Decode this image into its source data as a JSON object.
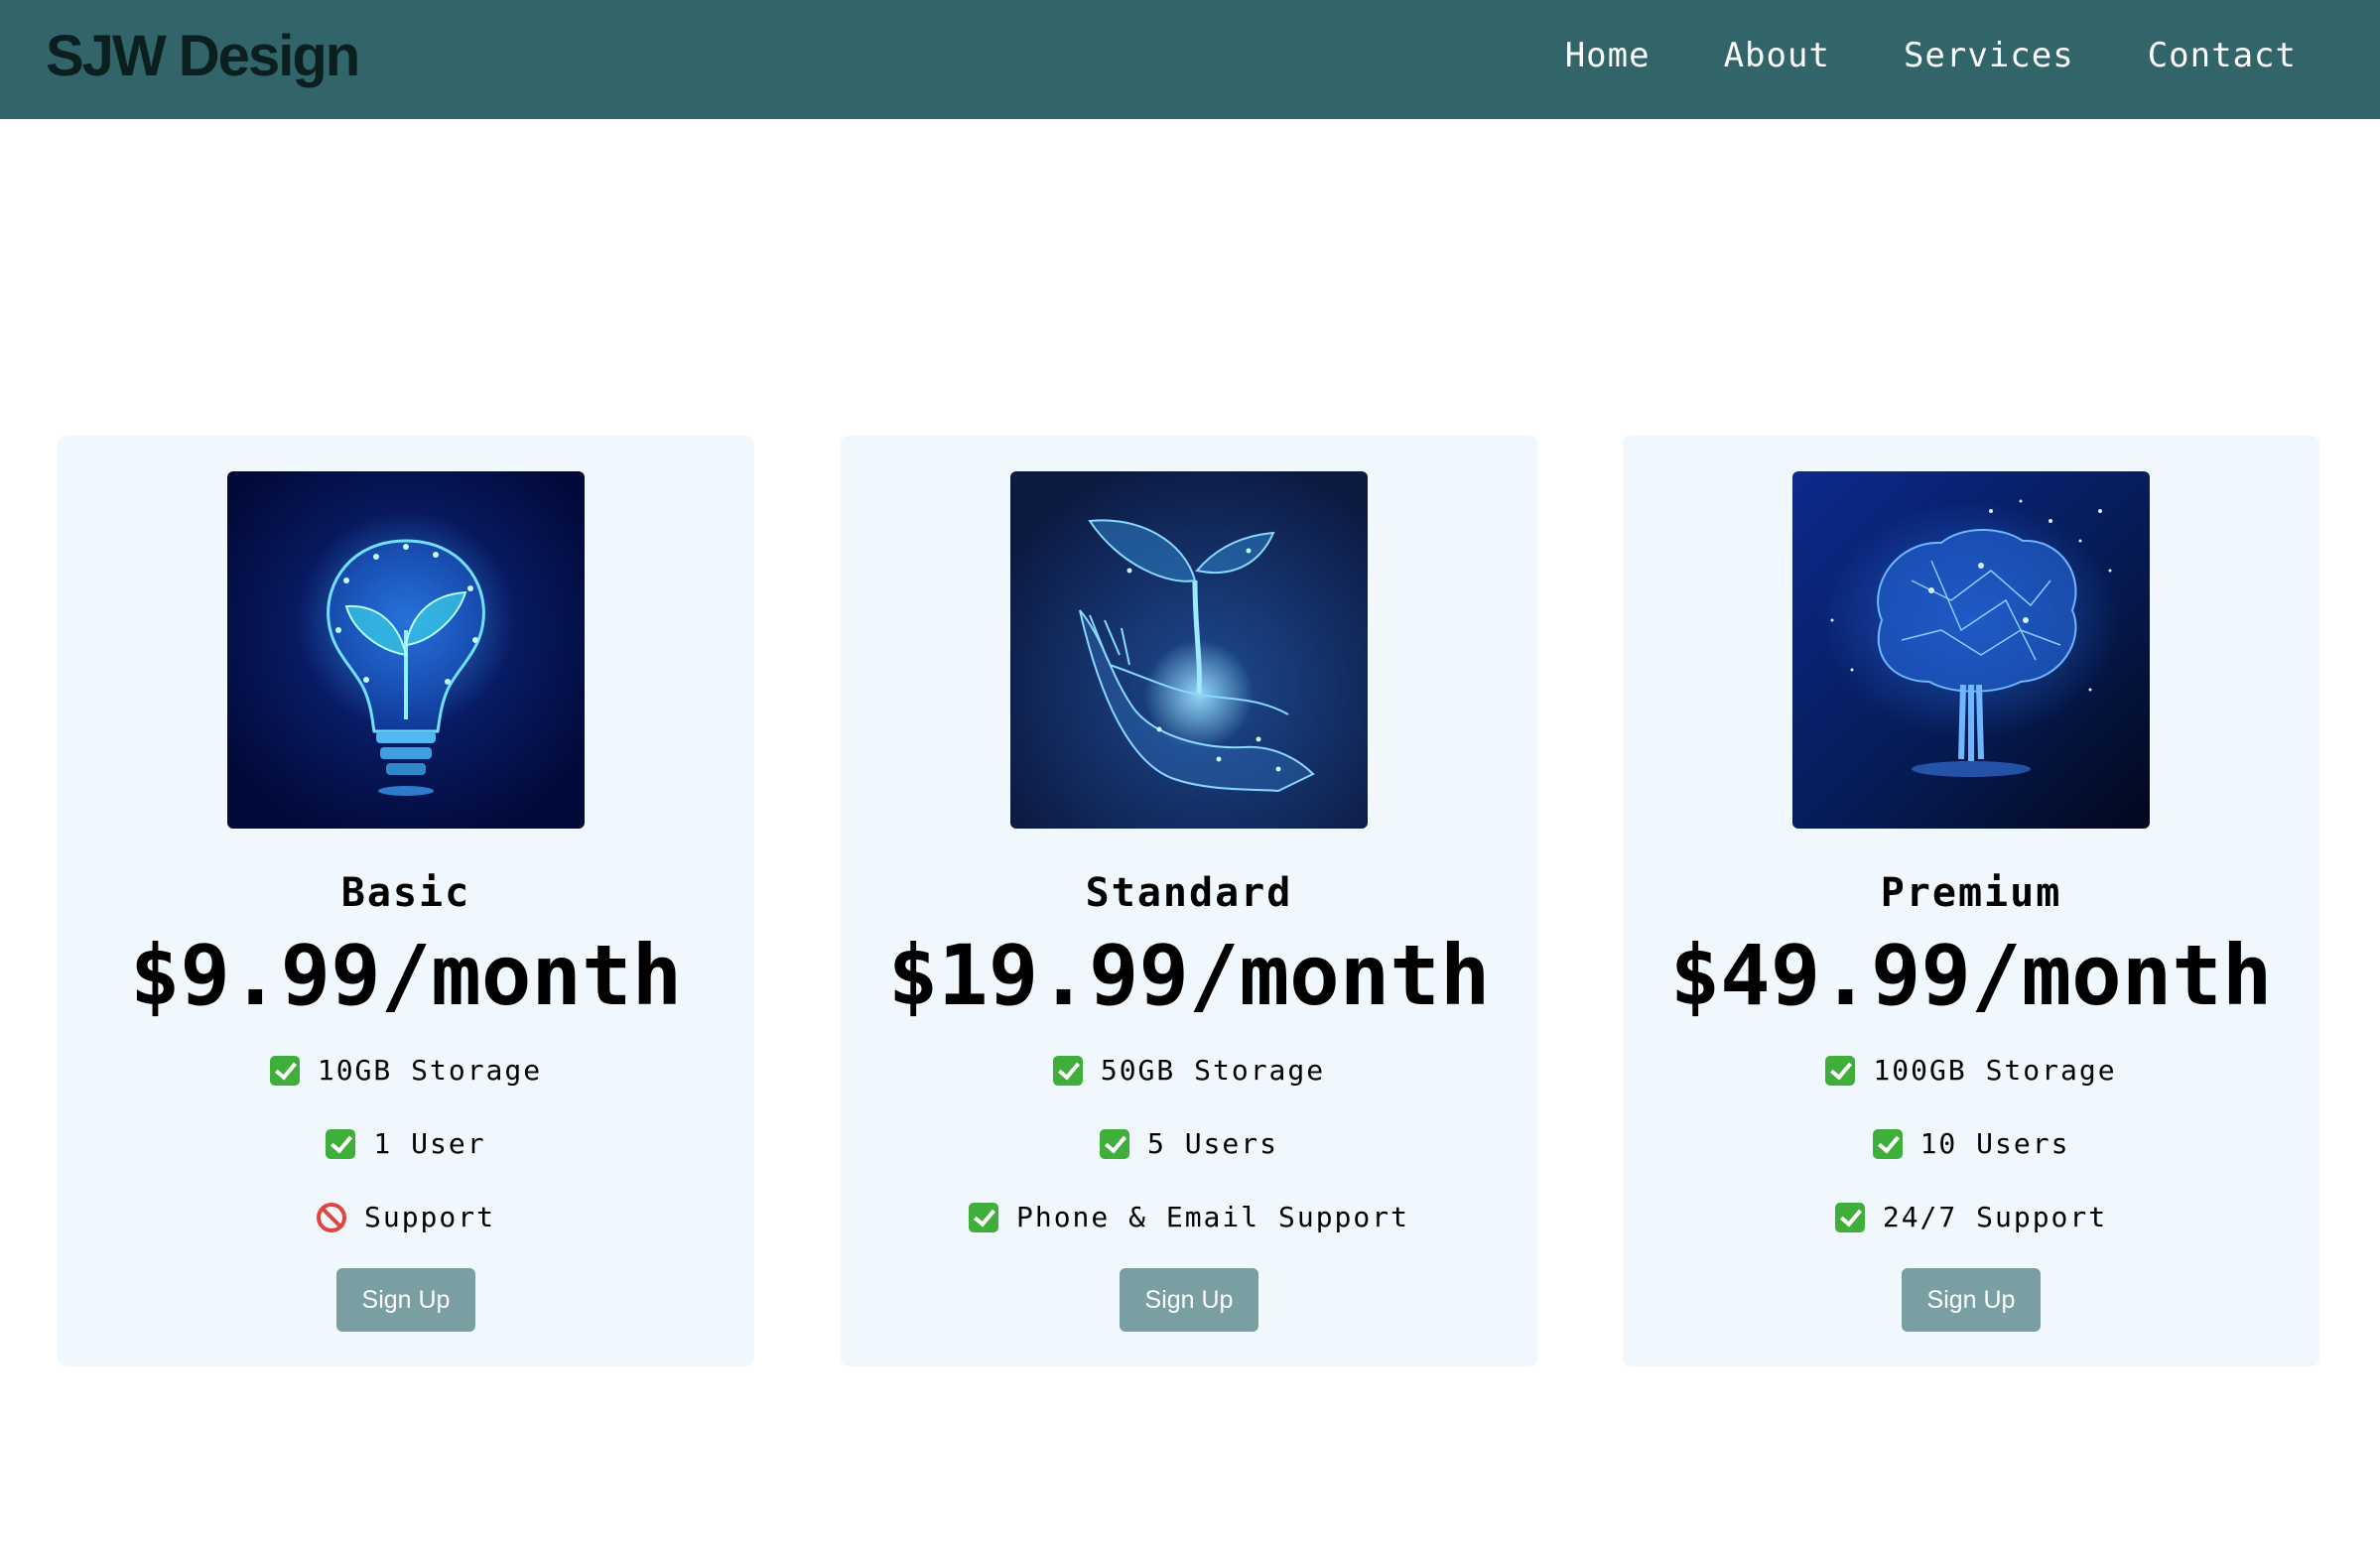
{
  "header": {
    "brand": "SJW Design",
    "nav": [
      "Home",
      "About",
      "Services",
      "Contact"
    ],
    "background_color": "#31656a"
  },
  "plans": [
    {
      "name": "Basic",
      "price": "$9.99/month",
      "image_icon": "lightbulb-sprout-icon",
      "features": [
        {
          "icon": "check-mark-icon",
          "text": "10GB Storage"
        },
        {
          "icon": "check-mark-icon",
          "text": "1 User"
        },
        {
          "icon": "prohibited-icon",
          "text": "Support"
        }
      ],
      "button_label": "Sign Up"
    },
    {
      "name": "Standard",
      "price": "$19.99/month",
      "image_icon": "hand-sprout-icon",
      "features": [
        {
          "icon": "check-mark-icon",
          "text": "50GB Storage"
        },
        {
          "icon": "check-mark-icon",
          "text": "5 Users"
        },
        {
          "icon": "check-mark-icon",
          "text": "Phone & Email Support"
        }
      ],
      "button_label": "Sign Up"
    },
    {
      "name": "Premium",
      "price": "$49.99/month",
      "image_icon": "glowing-tree-icon",
      "features": [
        {
          "icon": "check-mark-icon",
          "text": "100GB Storage"
        },
        {
          "icon": "check-mark-icon",
          "text": "10 Users"
        },
        {
          "icon": "check-mark-icon",
          "text": "24/7 Support"
        }
      ],
      "button_label": "Sign Up"
    }
  ],
  "colors": {
    "card_background": "#f0f7fd",
    "button_background": "#7a9fa3",
    "check_green": "#3fae3a",
    "prohibited_red": "#e0463e"
  }
}
